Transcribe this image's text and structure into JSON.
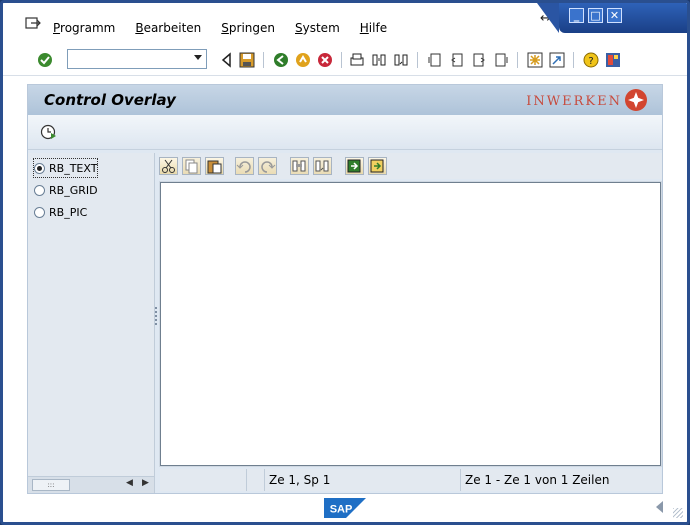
{
  "menubar": {
    "items": [
      {
        "u": "P",
        "rest": "rogramm"
      },
      {
        "u": "B",
        "rest": "earbeiten"
      },
      {
        "u": "S",
        "rest": "pringen"
      },
      {
        "u": "S",
        "rest": "ystem"
      },
      {
        "u": "H",
        "rest": "ilfe"
      }
    ]
  },
  "toolbar": {
    "command_field_value": "",
    "icons": [
      "enter-icon",
      "back-icon",
      "save-icon",
      "back-green-icon",
      "exit-icon",
      "cancel-icon",
      "print-icon",
      "find-icon",
      "find-next-icon",
      "first-page-icon",
      "prev-page-icon",
      "next-page-icon",
      "last-page-icon",
      "new-session-icon",
      "shortcut-icon",
      "help-icon",
      "customize-layout-icon"
    ]
  },
  "title": {
    "text": "Control Overlay",
    "brand": "INWERKEN"
  },
  "radio_options": [
    {
      "label": "RB_TEXT",
      "selected": true
    },
    {
      "label": "RB_GRID",
      "selected": false
    },
    {
      "label": "RB_PIC",
      "selected": false
    }
  ],
  "editor": {
    "icons": [
      "cut-icon",
      "copy-icon",
      "paste-icon",
      "undo-icon",
      "redo-icon",
      "find-icon",
      "find-next-icon",
      "load-file-icon",
      "save-file-icon"
    ],
    "status": {
      "position": "Ze 1, Sp 1",
      "range": "Ze 1 - Ze 1 von 1 Zeilen"
    }
  },
  "footer": {
    "logo": "SAP"
  },
  "colors": {
    "window_border": "#2a4f8f",
    "brand": "#c74a3c",
    "title_bar": "#aec3d9"
  }
}
